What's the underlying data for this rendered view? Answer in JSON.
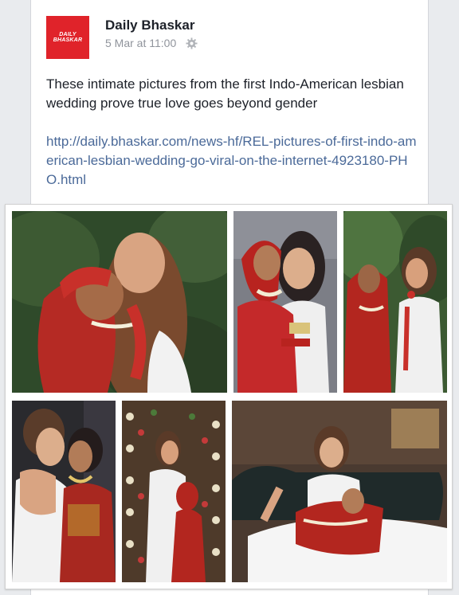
{
  "post": {
    "page_name": "Daily Bhaskar",
    "timestamp": "5 Mar at 11:00",
    "privacy_icon": "gear-icon",
    "logo_text_line1": "DAILY",
    "logo_text_line2": "BHASKAR",
    "message": "These intimate pictures from the first Indo-American lesbian wedding prove true love goes beyond gender",
    "link": "http://daily.bhaskar.com/news-hf/REL-pictures-of-first-indo-american-lesbian-wedding-go-viral-on-the-internet-4923180-PHO.html"
  },
  "colors": {
    "brand_red": "#e0232a",
    "link_blue": "#4b6a99",
    "meta_gray": "#90949c"
  },
  "photos": [
    "kiss-photo",
    "smiling-portrait-photo",
    "laughing-photo",
    "forehead-touch-photo",
    "flower-curtain-photo",
    "sofa-photo"
  ]
}
